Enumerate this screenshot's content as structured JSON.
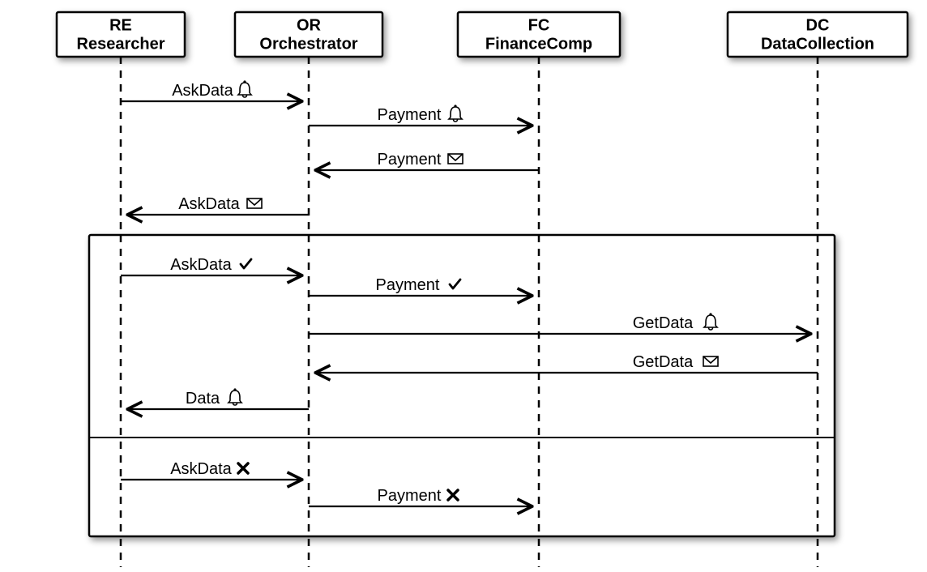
{
  "participants": [
    {
      "key": "RE",
      "code": "RE",
      "name": "Researcher"
    },
    {
      "key": "OR",
      "code": "OR",
      "name": "Orchestrator"
    },
    {
      "key": "FC",
      "code": "FC",
      "name": "FinanceComp"
    },
    {
      "key": "DC",
      "code": "DC",
      "name": "DataCollection"
    }
  ],
  "messages": [
    {
      "key": "m0",
      "label": "AskData",
      "icon": "bell",
      "from": "RE",
      "to": "OR"
    },
    {
      "key": "m1",
      "label": "Payment",
      "icon": "bell",
      "from": "OR",
      "to": "FC"
    },
    {
      "key": "m2",
      "label": "Payment",
      "icon": "envelope",
      "from": "FC",
      "to": "OR"
    },
    {
      "key": "m3",
      "label": "AskData",
      "icon": "envelope",
      "from": "OR",
      "to": "RE"
    },
    {
      "key": "m4",
      "label": "AskData",
      "icon": "check",
      "from": "RE",
      "to": "OR"
    },
    {
      "key": "m5",
      "label": "Payment",
      "icon": "check",
      "from": "OR",
      "to": "FC"
    },
    {
      "key": "m6",
      "label": "GetData",
      "icon": "bell",
      "from": "OR",
      "to": "DC"
    },
    {
      "key": "m7",
      "label": "GetData",
      "icon": "envelope",
      "from": "DC",
      "to": "OR"
    },
    {
      "key": "m8",
      "label": "Data",
      "icon": "bell",
      "from": "OR",
      "to": "RE"
    },
    {
      "key": "m9",
      "label": "AskData",
      "icon": "cross",
      "from": "RE",
      "to": "OR"
    },
    {
      "key": "m10",
      "label": "Payment",
      "icon": "cross",
      "from": "OR",
      "to": "FC"
    }
  ],
  "icons": {
    "bell": "🔔",
    "envelope": "✉",
    "check": "✓",
    "cross": "✘"
  }
}
